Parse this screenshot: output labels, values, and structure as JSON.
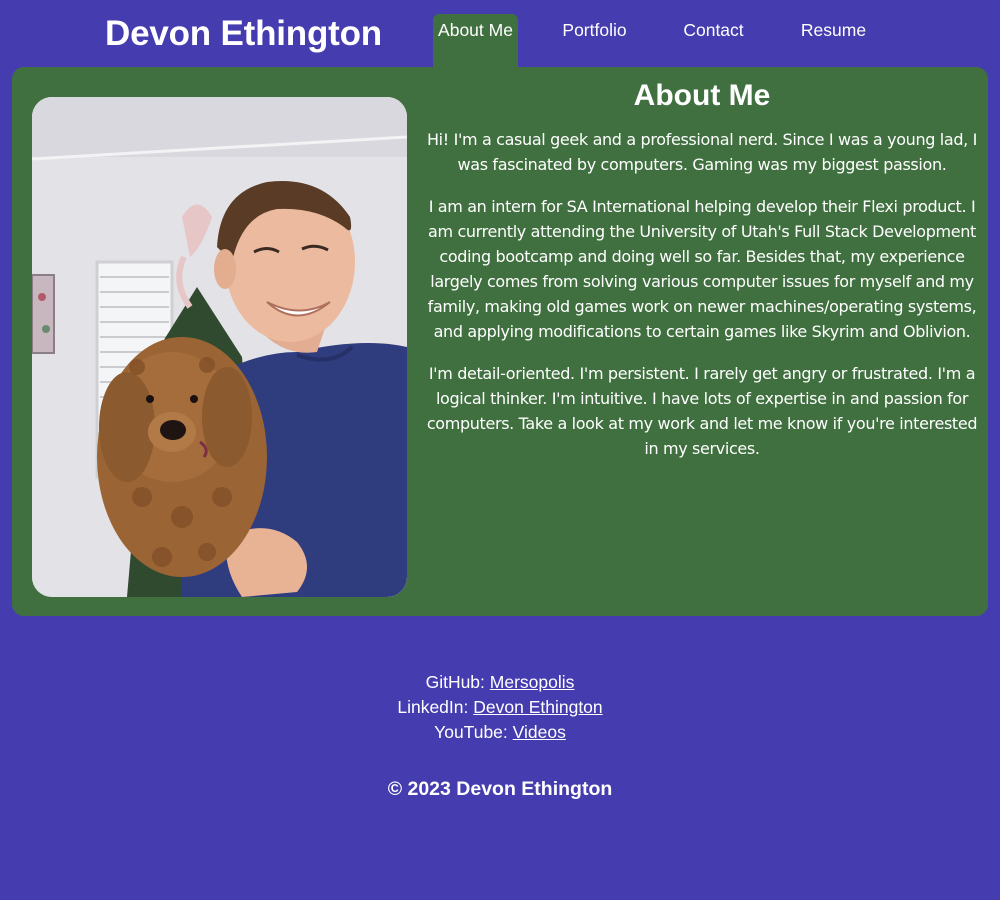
{
  "header": {
    "site_name": "Devon Ethington",
    "nav": [
      {
        "label": "About Me",
        "active": true
      },
      {
        "label": "Portfolio",
        "active": false
      },
      {
        "label": "Contact",
        "active": false
      },
      {
        "label": "Resume",
        "active": false
      }
    ]
  },
  "about": {
    "title": "About Me",
    "paragraphs": [
      "Hi! I'm a casual geek and a professional nerd. Since I was a young lad, I was fascinated by computers. Gaming was my biggest passion.",
      "I am an intern for SA International helping develop their Flexi product. I am currently attending the University of Utah's Full Stack Development coding bootcamp and doing well so far. Besides that, my experience largely comes from solving various computer issues for myself and my family, making old games work on newer machines/operating systems, and applying modifications to certain games like Skyrim and Oblivion.",
      "I'm detail-oriented. I'm persistent. I rarely get angry or frustrated. I'm a logical thinker. I'm intuitive. I have lots of expertise in and passion for computers. Take a look at my work and let me know if you're interested in my services."
    ]
  },
  "footer": {
    "links": [
      {
        "label": "GitHub:",
        "link_text": "Mersopolis"
      },
      {
        "label": "LinkedIn:",
        "link_text": "Devon Ethington"
      },
      {
        "label": "YouTube:",
        "link_text": "Videos"
      }
    ],
    "copyright": "© 2023 Devon Ethington"
  },
  "colors": {
    "page_background": "#443caf",
    "panel_green": "#417040",
    "text": "#ffffff"
  }
}
